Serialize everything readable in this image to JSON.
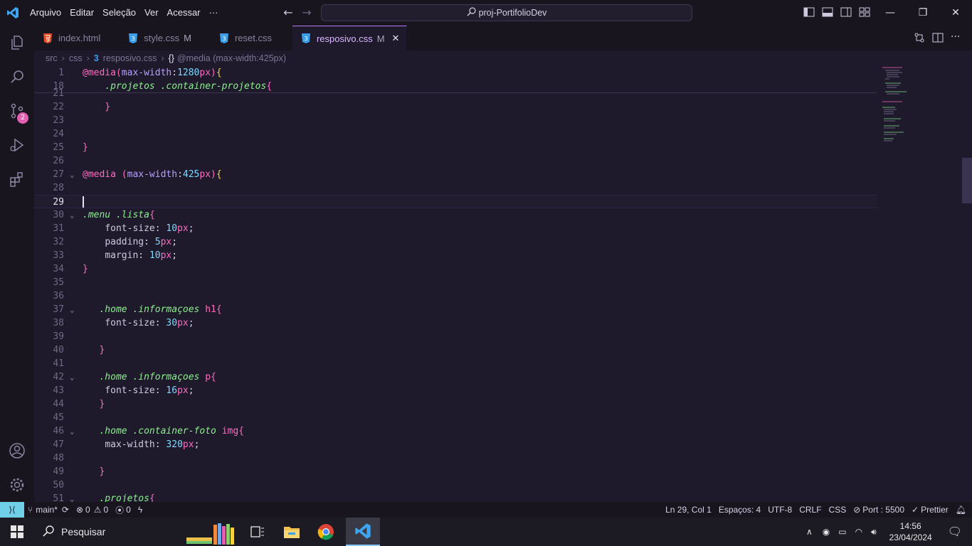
{
  "titlebar": {
    "menus": [
      "Arquivo",
      "Editar",
      "Seleção",
      "Ver",
      "Acessar",
      "···"
    ],
    "search": "proj-PortifolioDev"
  },
  "activity": {
    "badge_count": "2"
  },
  "tabs": [
    {
      "label": "index.html",
      "icon": "html-file-icon",
      "modified": ""
    },
    {
      "label": "style.css",
      "icon": "css-file-icon",
      "modified": "M"
    },
    {
      "label": "reset.css",
      "icon": "css-file-icon",
      "modified": ""
    },
    {
      "label": "resposivo.css",
      "icon": "css-file-icon",
      "modified": "M",
      "active": true
    }
  ],
  "breadcrumb": {
    "parts": [
      "src",
      "css",
      "resposivo.css",
      "@media (max-width:425px)"
    ]
  },
  "editor": {
    "sticky": [
      {
        "ln": "1",
        "code": "@media(max-width:1280px){"
      },
      {
        "ln": "18",
        "code": "    .projetos .container-projetos{"
      }
    ],
    "lines": [
      {
        "ln": "21",
        "code": ""
      },
      {
        "ln": "22",
        "code": "    }"
      },
      {
        "ln": "23",
        "code": ""
      },
      {
        "ln": "24",
        "code": ""
      },
      {
        "ln": "25",
        "code": "}"
      },
      {
        "ln": "26",
        "code": ""
      },
      {
        "ln": "27",
        "code": "@media (max-width:425px){"
      },
      {
        "ln": "28",
        "code": ""
      },
      {
        "ln": "29",
        "code": ""
      },
      {
        "ln": "30",
        "code": ".menu .lista{"
      },
      {
        "ln": "31",
        "code": "    font-size: 10px;"
      },
      {
        "ln": "32",
        "code": "    padding: 5px;"
      },
      {
        "ln": "33",
        "code": "    margin: 10px;"
      },
      {
        "ln": "34",
        "code": "}"
      },
      {
        "ln": "35",
        "code": ""
      },
      {
        "ln": "36",
        "code": ""
      },
      {
        "ln": "37",
        "code": "   .home .informaçoes h1{"
      },
      {
        "ln": "38",
        "code": "    font-size: 30px;"
      },
      {
        "ln": "39",
        "code": ""
      },
      {
        "ln": "40",
        "code": "   }"
      },
      {
        "ln": "41",
        "code": ""
      },
      {
        "ln": "42",
        "code": "   .home .informaçoes p{"
      },
      {
        "ln": "43",
        "code": "    font-size: 16px;"
      },
      {
        "ln": "44",
        "code": "   }"
      },
      {
        "ln": "45",
        "code": ""
      },
      {
        "ln": "46",
        "code": "   .home .container-foto img{"
      },
      {
        "ln": "47",
        "code": "    max-width: 320px;"
      },
      {
        "ln": "48",
        "code": ""
      },
      {
        "ln": "49",
        "code": "   }"
      },
      {
        "ln": "50",
        "code": ""
      },
      {
        "ln": "51",
        "code": "   .projetos{"
      }
    ]
  },
  "statusbar": {
    "branch": "main*",
    "errors": "0",
    "warnings": "0",
    "ports": "0",
    "position": "Ln 29, Col 1",
    "spaces": "Espaços: 4",
    "encoding": "UTF-8",
    "eol": "CRLF",
    "language": "CSS",
    "port": "Port : 5500",
    "prettier": "Prettier"
  },
  "taskbar": {
    "search": "Pesquisar",
    "time": "14:56",
    "date": "23/04/2024"
  },
  "colors": {
    "accent": "#b57cf5",
    "bg": "#1e1a2b",
    "status_remote": "#6fd0e8"
  }
}
